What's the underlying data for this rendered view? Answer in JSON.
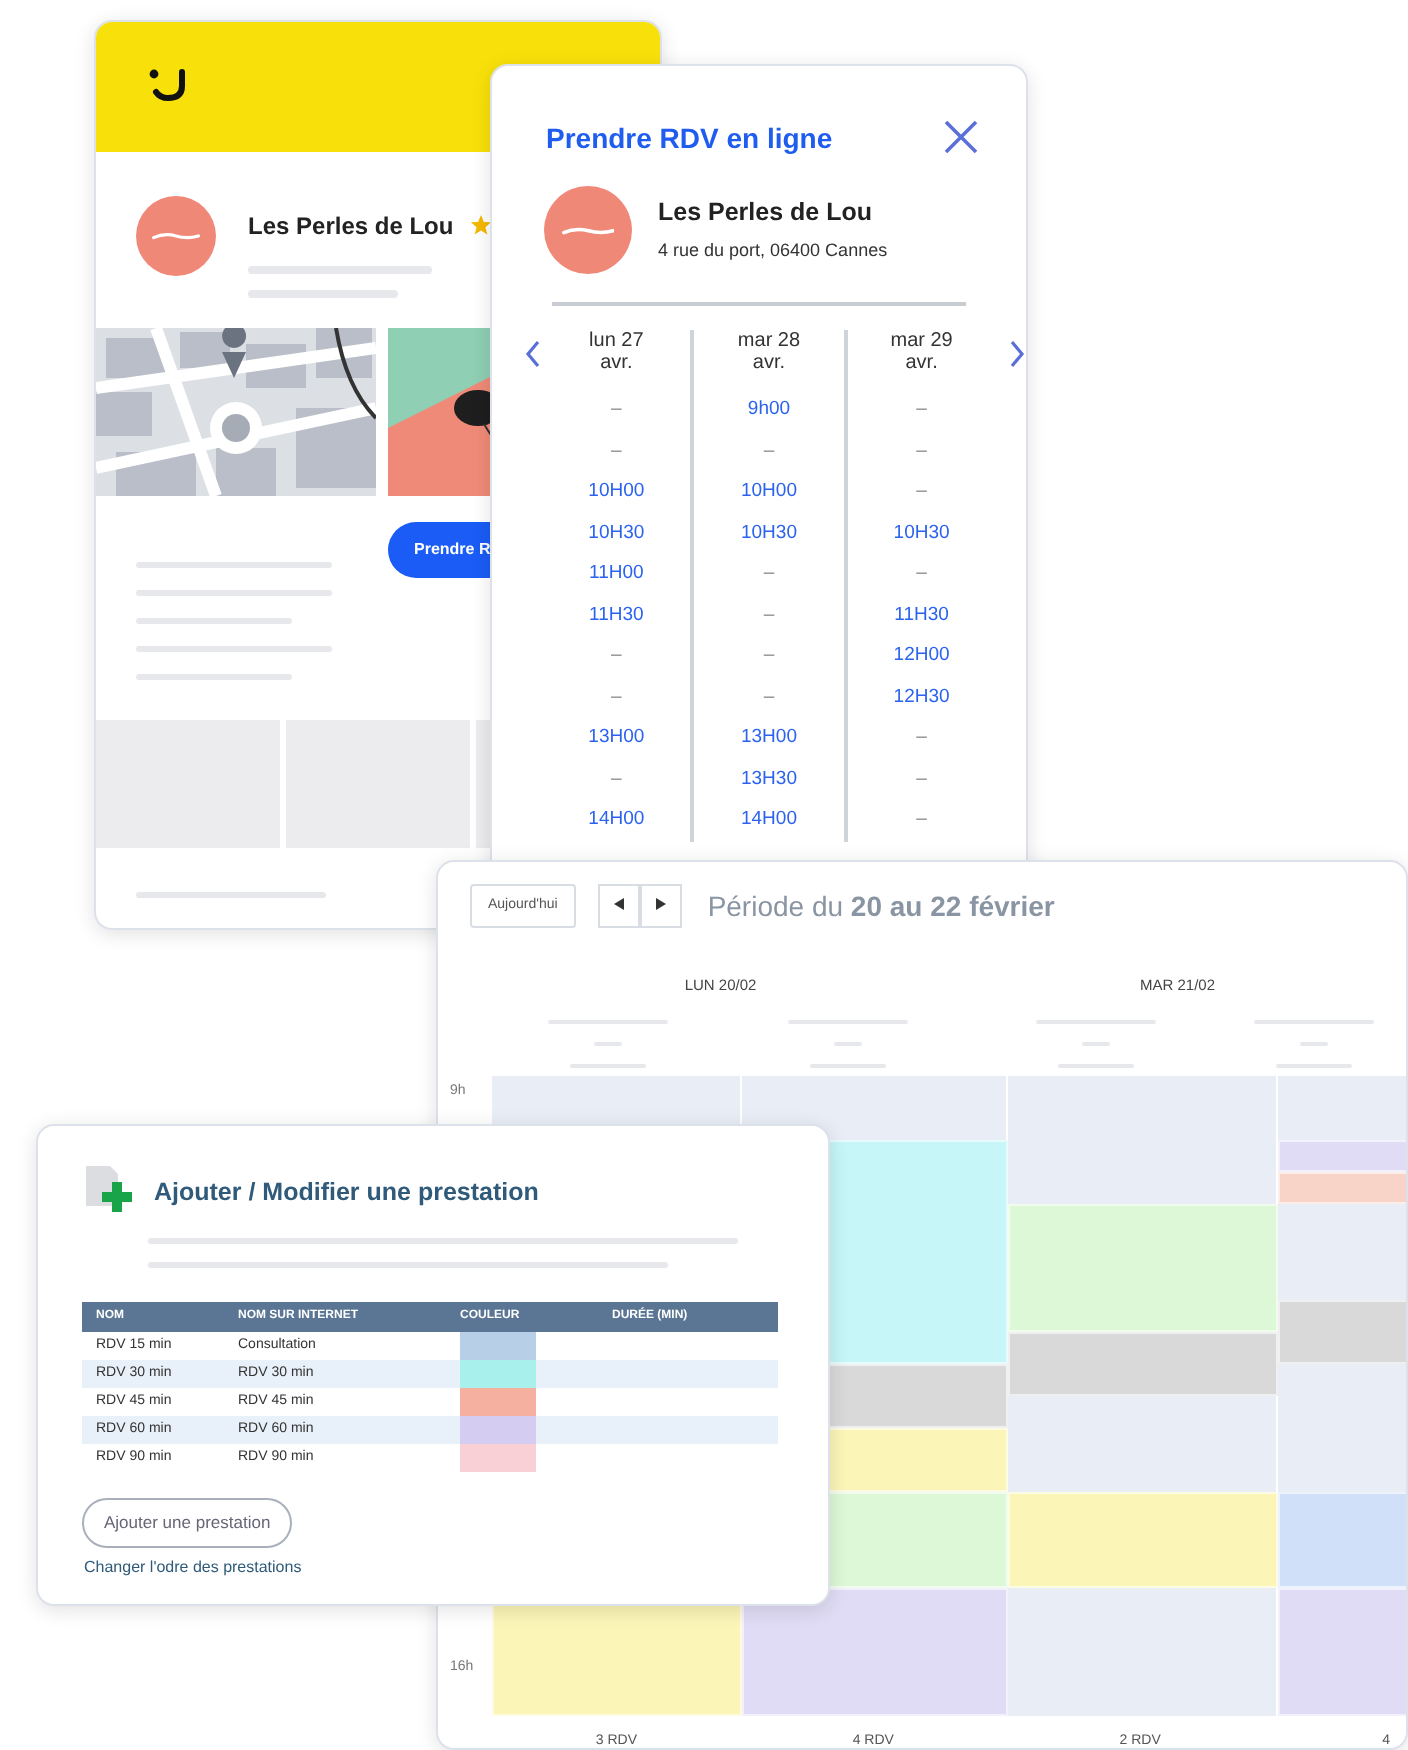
{
  "profile_card": {
    "business_name": "Les Perles de Lou",
    "booking_button": "Prendre R"
  },
  "booking_modal": {
    "title": "Prendre RDV en ligne",
    "business_name": "Les Perles de Lou",
    "address": "4 rue du port, 06400 Cannes",
    "days": [
      {
        "label": "lun 27 avr.",
        "slots": [
          {
            "text": "–",
            "available": false
          },
          {
            "text": "–",
            "available": false
          },
          {
            "text": "10H00",
            "available": true
          },
          {
            "text": "10H30",
            "available": true
          },
          {
            "text": "11H00",
            "available": true
          },
          {
            "text": "11H30",
            "available": true
          },
          {
            "text": "–",
            "available": false
          },
          {
            "text": "–",
            "available": false
          },
          {
            "text": "13H00",
            "available": true
          },
          {
            "text": "–",
            "available": false
          },
          {
            "text": "14H00",
            "available": true
          }
        ]
      },
      {
        "label": "mar 28 avr.",
        "slots": [
          {
            "text": "9h00",
            "available": true
          },
          {
            "text": "–",
            "available": false
          },
          {
            "text": "10H00",
            "available": true
          },
          {
            "text": "10H30",
            "available": true
          },
          {
            "text": "–",
            "available": false
          },
          {
            "text": "–",
            "available": false
          },
          {
            "text": "–",
            "available": false
          },
          {
            "text": "–",
            "available": false
          },
          {
            "text": "13H00",
            "available": true
          },
          {
            "text": "13H30",
            "available": true
          },
          {
            "text": "14H00",
            "available": true
          }
        ]
      },
      {
        "label": "mar 29 avr.",
        "slots": [
          {
            "text": "–",
            "available": false
          },
          {
            "text": "–",
            "available": false
          },
          {
            "text": "–",
            "available": false
          },
          {
            "text": "10H30",
            "available": true
          },
          {
            "text": "–",
            "available": false
          },
          {
            "text": "11H30",
            "available": true
          },
          {
            "text": "12H00",
            "available": true
          },
          {
            "text": "12H30",
            "available": true
          },
          {
            "text": "–",
            "available": false
          },
          {
            "text": "–",
            "available": false
          },
          {
            "text": "–",
            "available": false
          }
        ]
      }
    ]
  },
  "calendar": {
    "today_button": "Aujourd'hui",
    "period": "Période du **20 au 22 février**",
    "days": [
      {
        "label": "LUN 20/02"
      },
      {
        "label": "MAR 21/02"
      }
    ],
    "hours": [
      {
        "label": "9h"
      },
      {
        "label": "16h"
      }
    ],
    "columns": [
      {
        "total": "3 RDV",
        "events": [
          {
            "color": "#fbf5b8"
          }
        ]
      },
      {
        "total": "4 RDV",
        "events": [
          {
            "color": "#c6f6f8"
          },
          {
            "color": "#d9d9d9"
          },
          {
            "color": "#fbf5b8"
          },
          {
            "color": "#dcf8d6"
          },
          {
            "color": "#e0dcf5"
          }
        ]
      },
      {
        "total": "2 RDV",
        "events": [
          {
            "color": "#dcf8d6"
          },
          {
            "color": "#d9d9d9"
          },
          {
            "color": "#fbf5b8"
          }
        ]
      },
      {
        "total": "4",
        "events": [
          {
            "color": "#e0dcf5"
          },
          {
            "color": "#f8d3c8"
          },
          {
            "color": "#d9d9d9"
          },
          {
            "color": "#cfe0f8"
          },
          {
            "color": "#e0dcf5"
          }
        ]
      }
    ]
  },
  "services_panel": {
    "title": "Ajouter / Modifier une prestation",
    "columns": [
      "NOM",
      "NOM SUR INTERNET",
      "COULEUR",
      "DURÉE (MIN)"
    ],
    "rows": [
      {
        "name": "RDV 15 min",
        "internet_name": "Consultation",
        "color": "#b8cfe8"
      },
      {
        "name": "RDV 30 min",
        "internet_name": "RDV 30 min",
        "color": "#a8f0ec"
      },
      {
        "name": "RDV 45 min",
        "internet_name": "RDV 45 min",
        "color": "#f5b0a0"
      },
      {
        "name": "RDV 60 min",
        "internet_name": "RDV 60 min",
        "color": "#d5ccf2"
      },
      {
        "name": "RDV 90 min",
        "internet_name": "RDV 90 min",
        "color": "#f8d0d6"
      }
    ],
    "add_button": "Ajouter une prestation",
    "reorder_link": "Changer l'odre des prestations"
  }
}
